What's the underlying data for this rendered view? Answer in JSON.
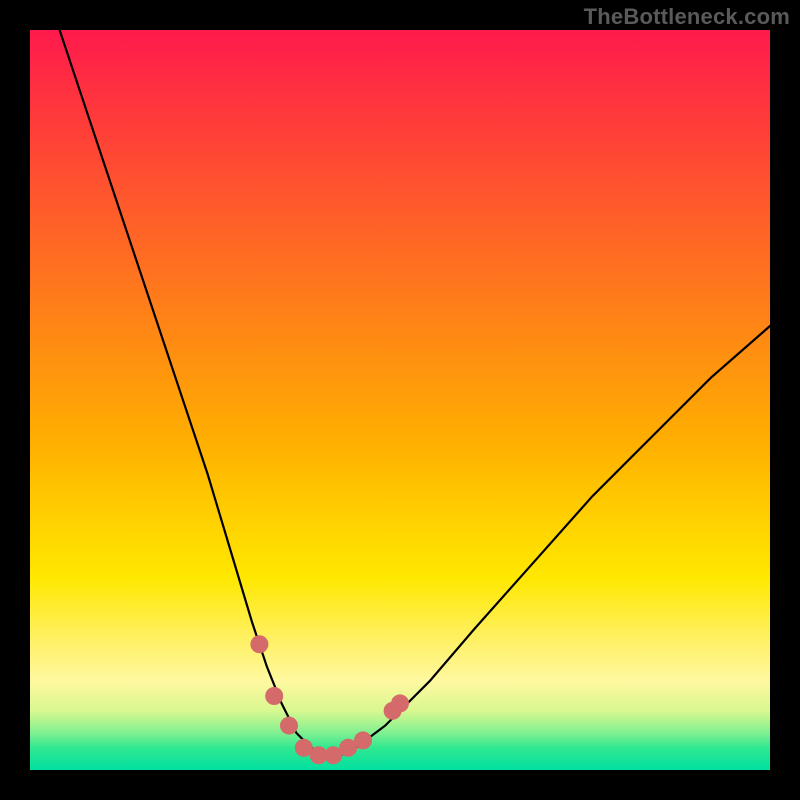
{
  "watermark": "TheBottleneck.com",
  "chart_data": {
    "type": "line",
    "title": "",
    "xlabel": "",
    "ylabel": "",
    "xlim": [
      0,
      100
    ],
    "ylim": [
      0,
      100
    ],
    "series": [
      {
        "name": "bottleneck-curve",
        "x": [
          4,
          8,
          12,
          16,
          20,
          24,
          27,
          30,
          32,
          34,
          36,
          38,
          40,
          42,
          44,
          48,
          54,
          60,
          68,
          76,
          84,
          92,
          100
        ],
        "y": [
          100,
          88,
          76,
          64,
          52,
          40,
          30,
          20,
          14,
          9,
          5,
          3,
          2,
          2,
          3,
          6,
          12,
          19,
          28,
          37,
          45,
          53,
          60
        ]
      }
    ],
    "markers": {
      "name": "highlight-dots",
      "color": "#d46a6a",
      "points": [
        {
          "x": 31,
          "y": 17
        },
        {
          "x": 33,
          "y": 10
        },
        {
          "x": 35,
          "y": 6
        },
        {
          "x": 37,
          "y": 3
        },
        {
          "x": 39,
          "y": 2
        },
        {
          "x": 41,
          "y": 2
        },
        {
          "x": 43,
          "y": 3
        },
        {
          "x": 45,
          "y": 4
        },
        {
          "x": 49,
          "y": 8
        },
        {
          "x": 50,
          "y": 9
        }
      ]
    },
    "background_gradient": {
      "top": "#ff1a4d",
      "mid": "#ffd000",
      "bottom": "#00e0a0"
    }
  }
}
